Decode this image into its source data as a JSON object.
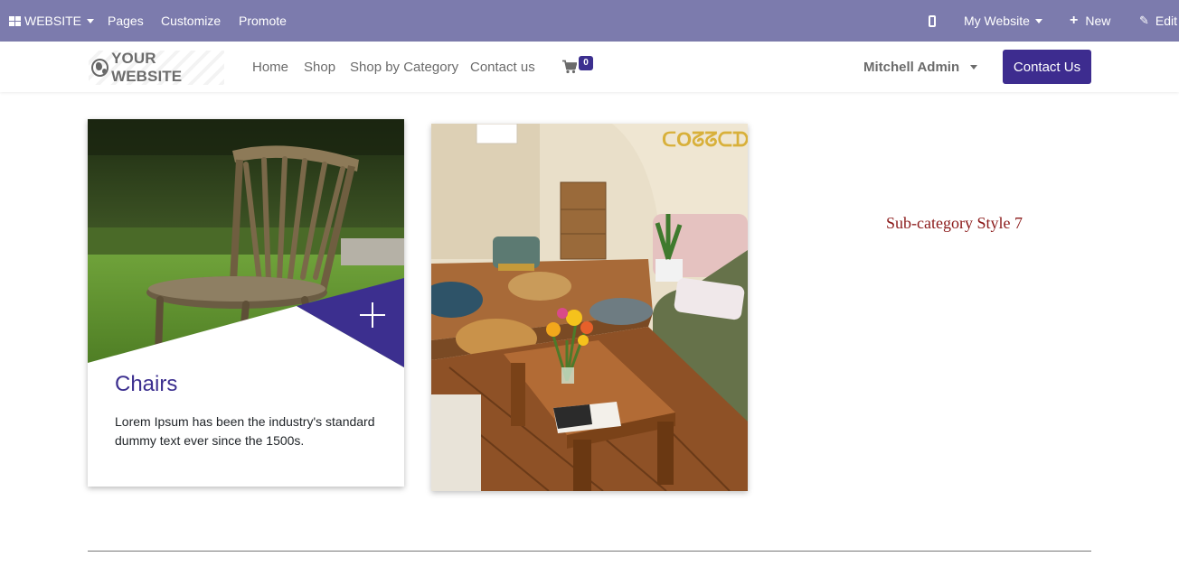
{
  "admin_bar": {
    "website_menu": "WEBSITE",
    "pages": "Pages",
    "customize": "Customize",
    "promote": "Promote",
    "my_website": "My Website",
    "new": "New",
    "edit": "Edit",
    "background_color": "#7c7bad"
  },
  "navbar": {
    "logo_text": "YOUR WEBSITE",
    "links": [
      "Home",
      "Shop",
      "Shop by Category",
      "Contact us"
    ],
    "cart_count": "0",
    "user_name": "Mitchell Admin",
    "cta_label": "Contact Us",
    "accent_color": "#3d2c8f"
  },
  "category_card": {
    "title": "Chairs",
    "description": "Lorem Ipsum has been the industry's standard dummy text ever since the 1500s."
  },
  "section_heading": "Sub-category Style 7"
}
